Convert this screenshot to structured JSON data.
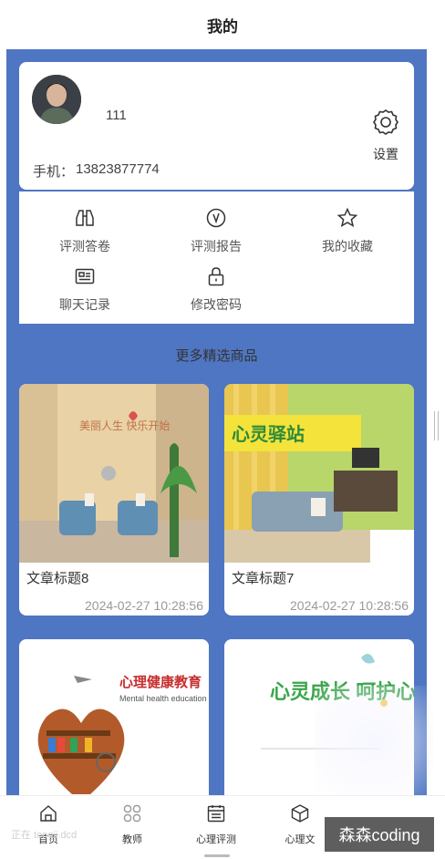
{
  "header": {
    "title": "我的"
  },
  "profile": {
    "username": "111",
    "phone_label": "手机：",
    "phone_value": "13823877774",
    "settings_label": "设置"
  },
  "menu": {
    "items": [
      {
        "label": "评测答卷",
        "icon": "binoculars-icon"
      },
      {
        "label": "评测报告",
        "icon": "report-check-icon"
      },
      {
        "label": "我的收藏",
        "icon": "star-icon"
      },
      {
        "label": "聊天记录",
        "icon": "chat-record-icon"
      },
      {
        "label": "修改密码",
        "icon": "lock-icon"
      }
    ]
  },
  "section": {
    "title": "更多精选商品"
  },
  "products": [
    {
      "title": "文章标题8",
      "date": "2024-02-27 10:28:56",
      "image_text": "美丽人生 快乐开始"
    },
    {
      "title": "文章标题7",
      "date": "2024-02-27 10:28:56",
      "image_text": "心灵驿站"
    },
    {
      "title": "",
      "date": "",
      "image_text": "心理健康教育",
      "image_subtext": "Mental health education"
    },
    {
      "title": "",
      "date": "",
      "image_text": "心灵成长 呵护心理"
    }
  ],
  "tabbar": {
    "tabs": [
      {
        "label": "首页",
        "icon": "home-icon"
      },
      {
        "label": "教师",
        "icon": "grid-icon"
      },
      {
        "label": "心理评测",
        "icon": "test-calendar-icon"
      },
      {
        "label": "心理文",
        "icon": "box-icon"
      }
    ]
  },
  "overlay": {
    "watermark": "森森coding",
    "faint_text": "正在 tongji.dcd"
  },
  "colors": {
    "main_bg": "#4f76c2",
    "card_bg": "#ffffff",
    "text_dark": "#333333",
    "text_muted": "#999999"
  }
}
